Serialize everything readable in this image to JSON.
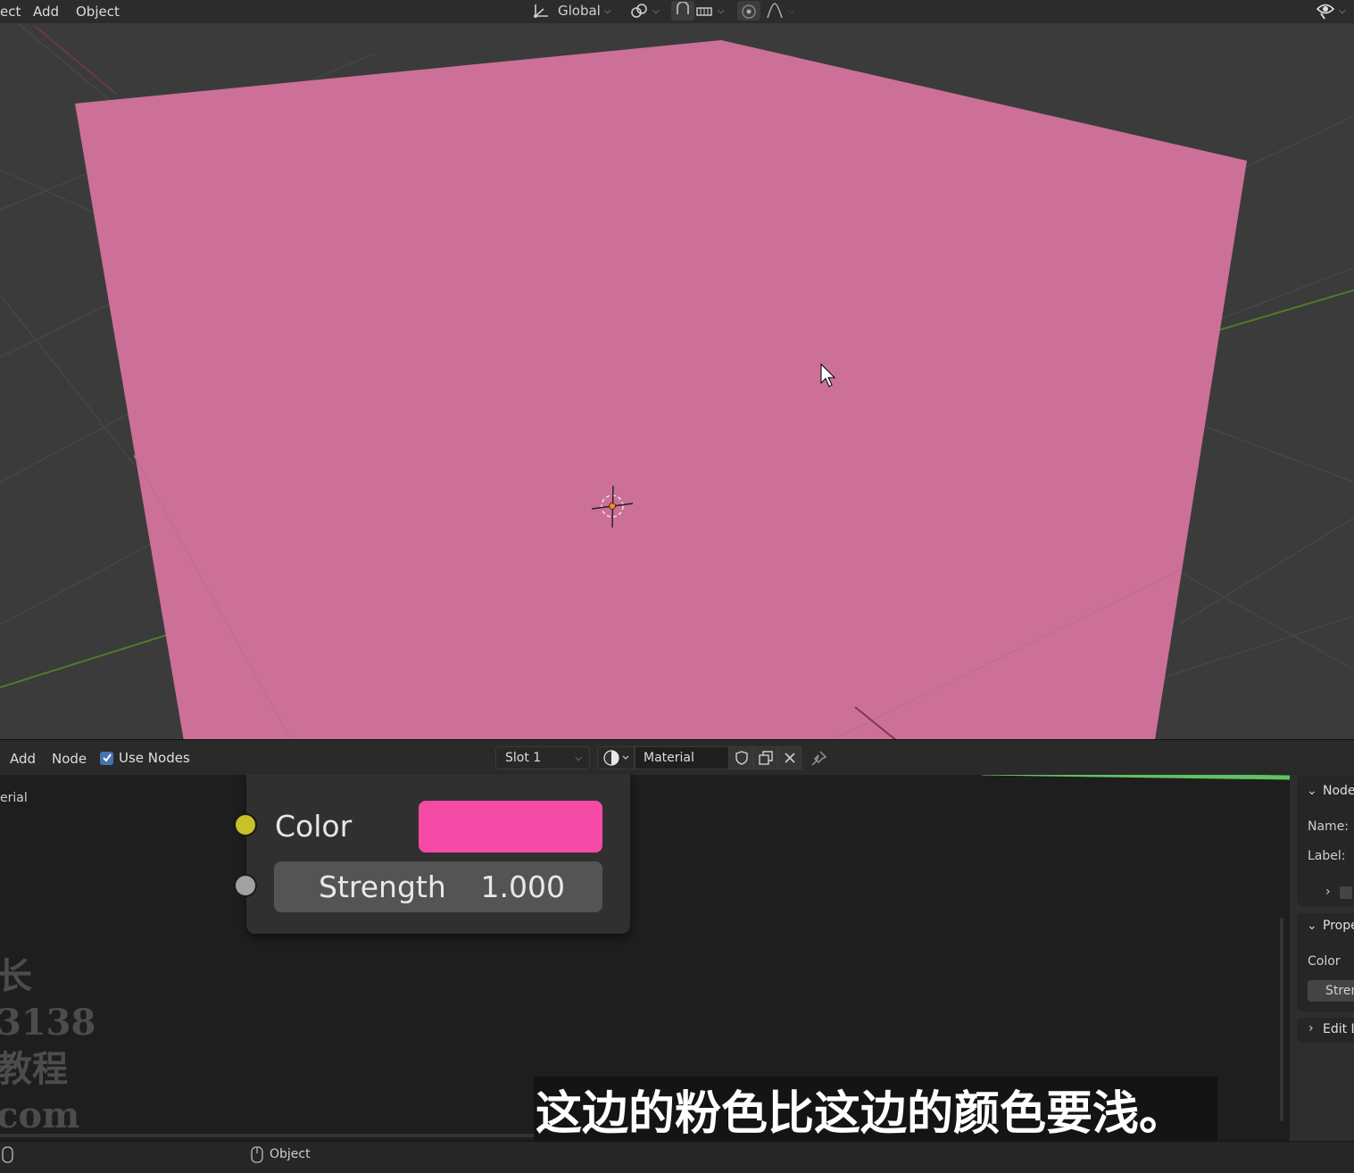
{
  "viewport_header": {
    "menus": [
      "ect",
      "Add",
      "Object"
    ],
    "transform_orientation": "Global"
  },
  "viewport": {
    "object_color": "#cc7098",
    "background_color": "#3b3b3b"
  },
  "node_editor_header": {
    "menus": [
      "Add",
      "Node"
    ],
    "use_nodes_label": "Use Nodes",
    "use_nodes_checked": true,
    "slot_label": "Slot 1",
    "material_name": "Material"
  },
  "node_editor": {
    "breadcrumb": "erial",
    "node": {
      "color_label": "Color",
      "color_value": "#f44aa6",
      "color_socket": "#c7c229",
      "strength_label": "Strength",
      "strength_value": "1.000",
      "strength_socket": "#a1a1a1"
    },
    "watermark": [
      "长",
      "3138",
      "教程",
      "com"
    ],
    "subtitle": "这边的粉色比这边的颜色要浅。"
  },
  "sidebar": {
    "node_panel_title": "Node",
    "name_label": "Name:",
    "label_label": "Label:",
    "properties_panel_title": "Prope",
    "properties_color_label": "Color",
    "properties_strength_label": "Stren",
    "edit_panel_title": "Edit L"
  },
  "statusbar": {
    "mode_label": "Object"
  }
}
